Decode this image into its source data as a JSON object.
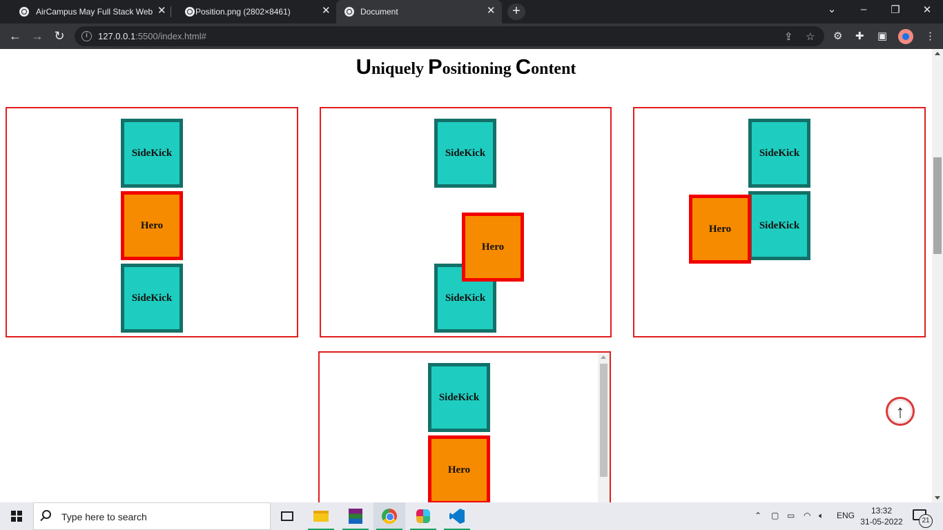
{
  "browser": {
    "tabs": [
      {
        "title": "AirCampus May Full Stack Web D",
        "active": false
      },
      {
        "title": "Position.png (2802×8461)",
        "active": false
      },
      {
        "title": "Document",
        "active": true
      }
    ],
    "new_tab_label": "+",
    "address": {
      "host": "127.0.0.1",
      "rest": ":5500/index.html#"
    }
  },
  "page": {
    "title_parts": [
      {
        "cap": "U",
        "rest": "niquely "
      },
      {
        "cap": "P",
        "rest": "ositioning "
      },
      {
        "cap": "C",
        "rest": "ontent"
      }
    ],
    "box1": {
      "top": "SideKick",
      "middle": "Hero",
      "bottom": "SideKick"
    },
    "box2": {
      "top": "SideKick",
      "hero": "Hero",
      "bottom": "SideKick"
    },
    "box3": {
      "top": "SideKick",
      "hero": "Hero",
      "right": "SideKick"
    },
    "box4": {
      "top": "SideKick",
      "hero": "Hero"
    },
    "scroll_top_icon": "arrow-up-icon"
  },
  "taskbar": {
    "search_placeholder": "Type here to search",
    "language": "ENG",
    "time": "13:32",
    "date": "31-05-2022",
    "notification_count": "21"
  },
  "colors": {
    "sidekick_fill": "#1ecdc0",
    "sidekick_border": "#137068",
    "hero_fill": "#f68b00",
    "hero_border": "#f20000",
    "container_border": "#e21b1b"
  }
}
